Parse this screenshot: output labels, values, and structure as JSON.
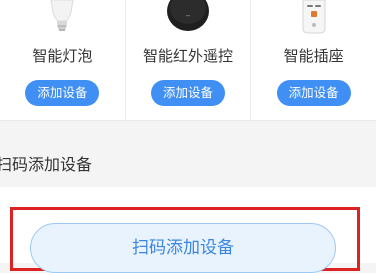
{
  "devices": [
    {
      "name": "智能灯泡",
      "button_label": "添加设备",
      "icon": "bulb-icon"
    },
    {
      "name": "智能红外遥控",
      "button_label": "添加设备",
      "icon": "ir-remote-icon"
    },
    {
      "name": "智能插座",
      "button_label": "添加设备",
      "icon": "smart-plug-icon"
    }
  ],
  "scan_section": {
    "title": "扫码添加设备",
    "button_label": "扫码添加设备"
  },
  "colors": {
    "accent": "#3f8ff4",
    "highlight": "#dd2222",
    "scan_button_bg": "#e9f3fd",
    "scan_button_text": "#3a86e0"
  }
}
